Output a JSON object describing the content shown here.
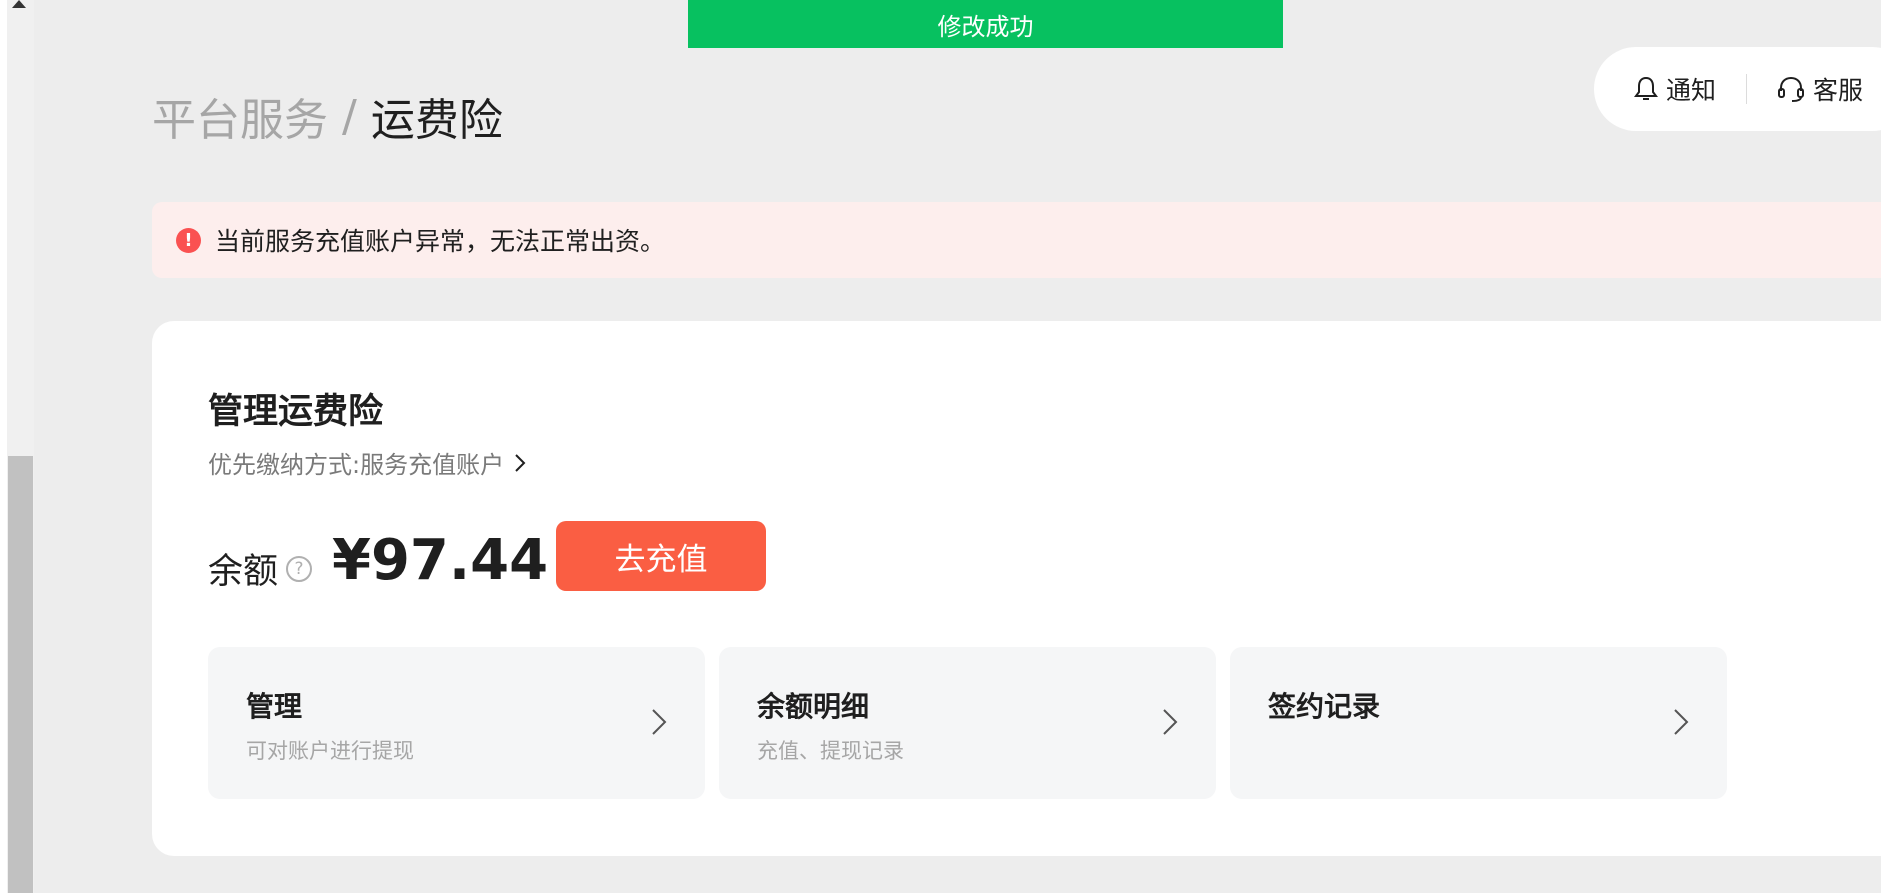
{
  "toast": {
    "text": "修改成功"
  },
  "breadcrumb": {
    "parent": "平台服务",
    "separator": "/",
    "current": "运费险"
  },
  "topbar": {
    "notify_label": "通知",
    "notify_icon": "bell-icon",
    "service_label": "客服",
    "service_icon": "headset-icon"
  },
  "alert": {
    "icon": "exclamation-icon",
    "text": "当前服务充值账户异常，无法正常出资。"
  },
  "card": {
    "title": "管理运费险",
    "pay_method": "优先缴纳方式:服务充值账户",
    "balance_label": "余额",
    "help_icon_glyph": "?",
    "balance_amount": "¥97.44",
    "recharge_button": "去充值",
    "tiles": [
      {
        "title": "管理",
        "desc": "可对账户进行提现"
      },
      {
        "title": "余额明细",
        "desc": "充值、提现记录"
      },
      {
        "title": "签约记录",
        "desc": ""
      }
    ]
  },
  "colors": {
    "toast_bg": "#07c160",
    "recharge_bg": "#fa5e43",
    "alert_bg": "#fdeeed",
    "alert_icon": "#fa5151"
  }
}
